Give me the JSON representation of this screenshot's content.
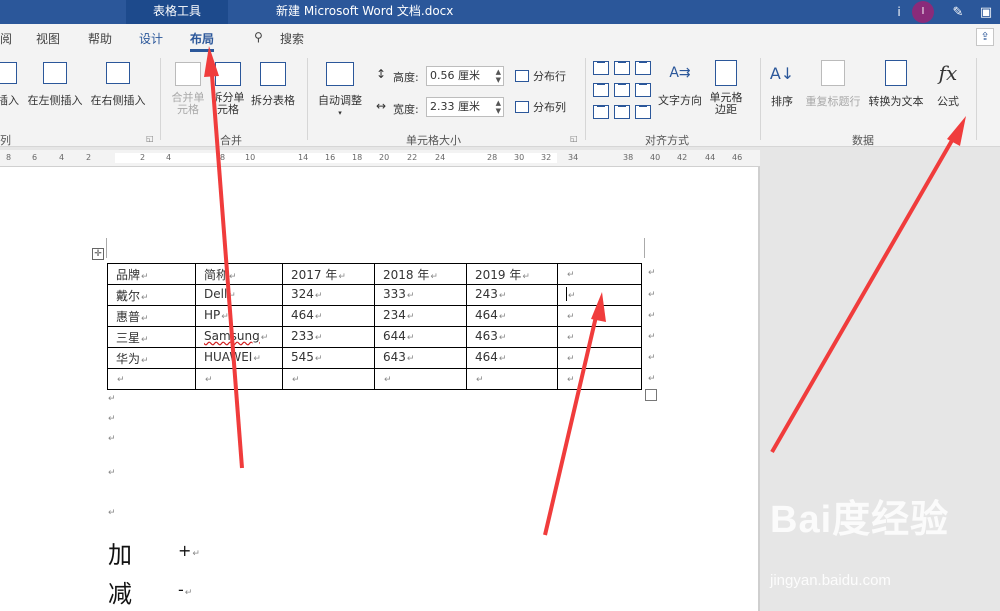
{
  "window": {
    "context_tab": "表格工具",
    "doc_title": "新建 Microsoft Word 文档.docx",
    "info_glyph": "i",
    "avatar_initial": "I"
  },
  "tabs": [
    "阅",
    "视图",
    "帮助",
    "设计",
    "布局",
    "搜索"
  ],
  "ribbon": {
    "rows_cols": {
      "insert_above": "插入",
      "insert_left": "在左侧插入",
      "insert_right": "在右侧插入",
      "group": "列"
    },
    "merge": {
      "merge_cells": "合并单元格",
      "split_cells": "拆分单元格",
      "split_table": "拆分表格",
      "group": "合并"
    },
    "cell_size": {
      "autofit": "自动调整",
      "height_label": "高度:",
      "height_value": "0.56 厘米",
      "width_label": "宽度:",
      "width_value": "2.33 厘米",
      "distribute_rows": "分布行",
      "distribute_cols": "分布列",
      "group": "单元格大小"
    },
    "alignment": {
      "text_direction": "文字方向",
      "cell_margins": "单元格边距",
      "group": "对齐方式"
    },
    "data": {
      "sort": "排序",
      "repeat_header": "重复标题行",
      "convert_to_text": "转换为文本",
      "formula": "公式",
      "group": "数据"
    }
  },
  "ruler": [
    "8",
    "6",
    "4",
    "2",
    "2",
    "4",
    "8",
    "10",
    "14",
    "16",
    "18",
    "20",
    "22",
    "24",
    "28",
    "30",
    "32",
    "34",
    "38",
    "40",
    "42",
    "44",
    "46"
  ],
  "table": {
    "rows": [
      [
        "品牌",
        "简称",
        "2017 年",
        "2018 年",
        "2019 年",
        ""
      ],
      [
        "戴尔",
        "Dell",
        "324",
        "333",
        "243",
        ""
      ],
      [
        "惠普",
        "HP",
        "464",
        "234",
        "464",
        ""
      ],
      [
        "三星",
        "Samsung",
        "233",
        "644",
        "463",
        ""
      ],
      [
        "华为",
        "HUAWEI",
        "545",
        "643",
        "464",
        ""
      ],
      [
        "",
        "",
        "",
        "",
        "",
        ""
      ]
    ]
  },
  "body_lines": [
    {
      "char": "加",
      "symbol": "+"
    },
    {
      "char": "减",
      "symbol": "-"
    }
  ],
  "watermark": {
    "logo": "Bai度经验",
    "url": "jingyan.baidu.com"
  },
  "colors": {
    "accent": "#2b579a",
    "annotation_arrow": "#f03c3c"
  }
}
